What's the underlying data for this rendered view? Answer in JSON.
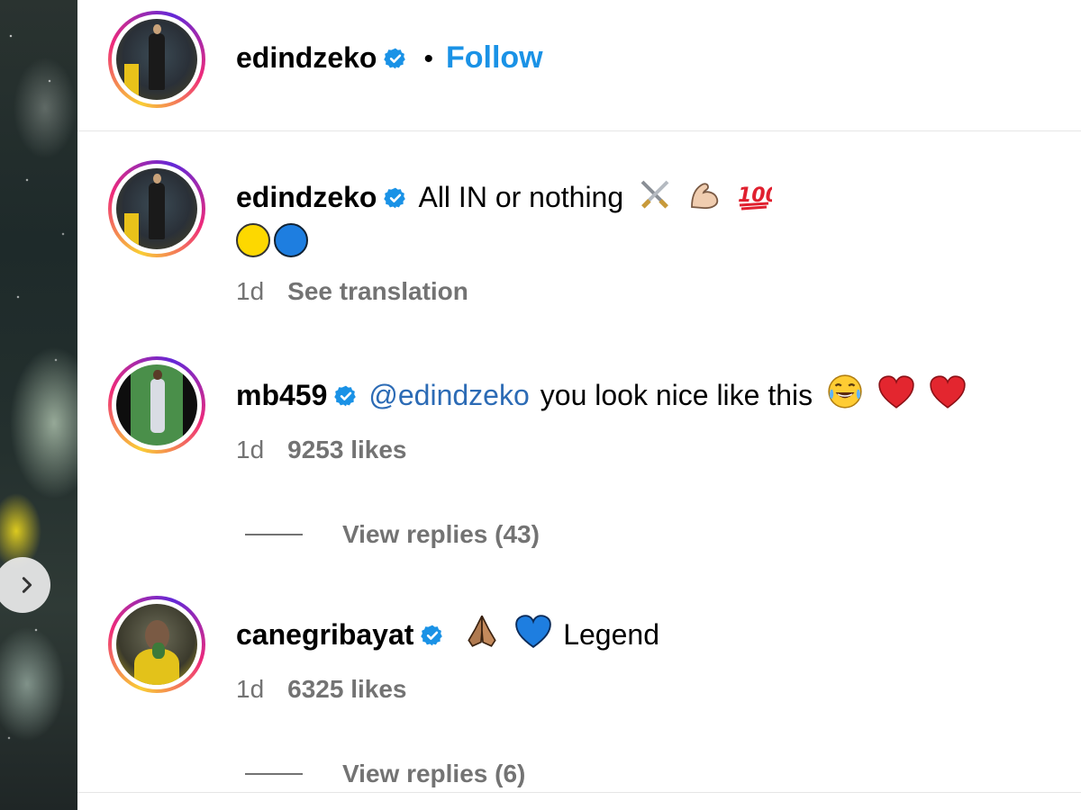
{
  "header": {
    "username": "edindzeko",
    "separator": "•",
    "follow_label": "Follow"
  },
  "comments": [
    {
      "username": "edindzeko",
      "text": "All IN or nothing",
      "emojis": [
        "crossed-swords-icon",
        "flexed-biceps-icon",
        "hundred-points-icon"
      ],
      "second_line_emojis": [
        "yellow-circle-icon",
        "blue-circle-icon"
      ],
      "time": "1d",
      "action": "See translation"
    },
    {
      "username": "mb459",
      "mention": "@edindzeko",
      "text": "you look nice like this",
      "emojis": [
        "tears-of-joy-icon",
        "red-heart-icon",
        "red-heart-icon"
      ],
      "time": "1d",
      "likes": "9253 likes",
      "view_replies": "View replies (43)"
    },
    {
      "username": "canegribayat",
      "text": "Legend",
      "emojis": [
        "folded-hands-icon",
        "blue-heart-icon"
      ],
      "time": "1d",
      "likes": "6325 likes",
      "view_replies": "View replies (6)"
    }
  ],
  "colors": {
    "follow": "#1a92e6",
    "mention": "#2c6bb5",
    "verified": "#1a92e6",
    "muted": "#737373",
    "yellow_circle": "#fdd800",
    "blue_circle": "#1e7ee0"
  }
}
